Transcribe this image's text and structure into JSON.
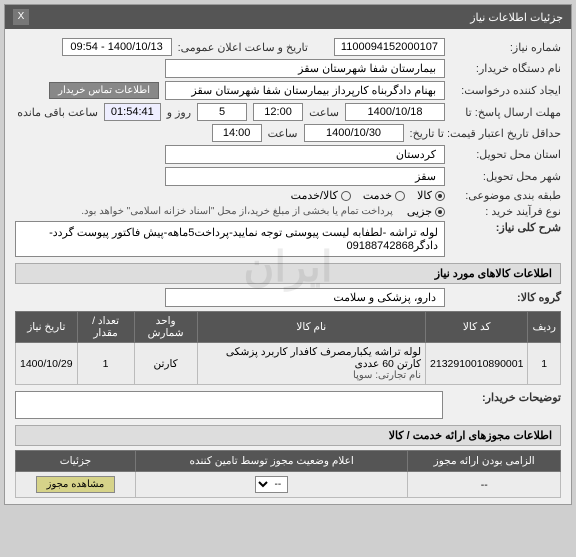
{
  "panel_title": "جزئیات اطلاعات نیاز",
  "close_x": "X",
  "fields": {
    "req_no_label": "شماره نیاز:",
    "req_no": "1100094152000107",
    "public_date_label": "تاریخ و ساعت اعلان عمومی:",
    "public_date": "1400/10/13 - 09:54",
    "buyer_org_label": "نام دستگاه خریدار:",
    "buyer_org": "بیمارستان شفا شهرستان سقز",
    "requester_label": "ایجاد کننده درخواست:",
    "requester": "بهنام دادگربناه کارپرداز بیمارستان شفا شهرستان سقز",
    "buyer_contact_btn": "اطلاعات تماس خریدار",
    "reply_due_label": "مهلت ارسال پاسخ: تا",
    "reply_due_date": "1400/10/18",
    "time_label": "ساعت",
    "reply_due_time": "12:00",
    "days_label": "روز و",
    "days_value": "5",
    "remaining_label": "ساعت باقی مانده",
    "remaining_time": "01:54:41",
    "price_valid_label": "حداقل تاریخ اعتبار قیمت: تا تاریخ:",
    "price_valid_date": "1400/10/30",
    "price_valid_time": "14:00",
    "province_label": "استان محل تحویل:",
    "province": "کردستان",
    "city_label": "شهر محل تحویل:",
    "city": "سقز",
    "category_label": "طبقه بندی موضوعی:",
    "cat_goods": "کالا",
    "cat_service": "خدمت",
    "cat_both": "کالا/خدمت",
    "process_type_label": "نوع فرآیند خرید :",
    "proc_small": "جزیی",
    "proc_note": "پرداخت تمام یا بخشی از مبلغ خرید،از محل \"اسناد خزانه اسلامی\" خواهد بود.",
    "summary_label": "شرح کلی نیاز:",
    "summary": "لوله تراشه -لطفابه لیست پیوستی توجه نمایید-پرداخت5ماهه-پیش فاکتور پیوست گردد-دادگر09188742868"
  },
  "goods": {
    "section": "اطلاعات کالاهای مورد نیاز",
    "group_label": "گروه کالا:",
    "group": "دارو، پزشکی و سلامت",
    "headers": {
      "idx": "ردیف",
      "code": "کد کالا",
      "name": "نام کالا",
      "unit": "واحد شمارش",
      "qty": "تعداد / مقدار",
      "reqdate": "تاریخ نیاز"
    },
    "rows": [
      {
        "idx": "1",
        "code": "2132910010890001",
        "name": "لوله تراشه یکبارمصرف کافدار کاربرد پزشکی کارتن 60 عددی",
        "brand_label": "نام تجارتی:",
        "brand": "سوپا",
        "unit": "کارتن",
        "qty": "1",
        "reqdate": "1400/10/29"
      }
    ],
    "buyer_notes_label": "توضیحات خریدار:"
  },
  "permits": {
    "section": "اطلاعات مجوزهای ارائه خدمت / کالا",
    "headers": {
      "mandatory": "الزامی بودن ارائه مجوز",
      "status": "اعلام وضعیت مجوز توسط تامین کننده",
      "details": "جزئیات"
    },
    "rows": [
      {
        "mandatory": "--",
        "status": "--",
        "btn": "مشاهده مجوز"
      }
    ]
  },
  "watermark": "ایران"
}
